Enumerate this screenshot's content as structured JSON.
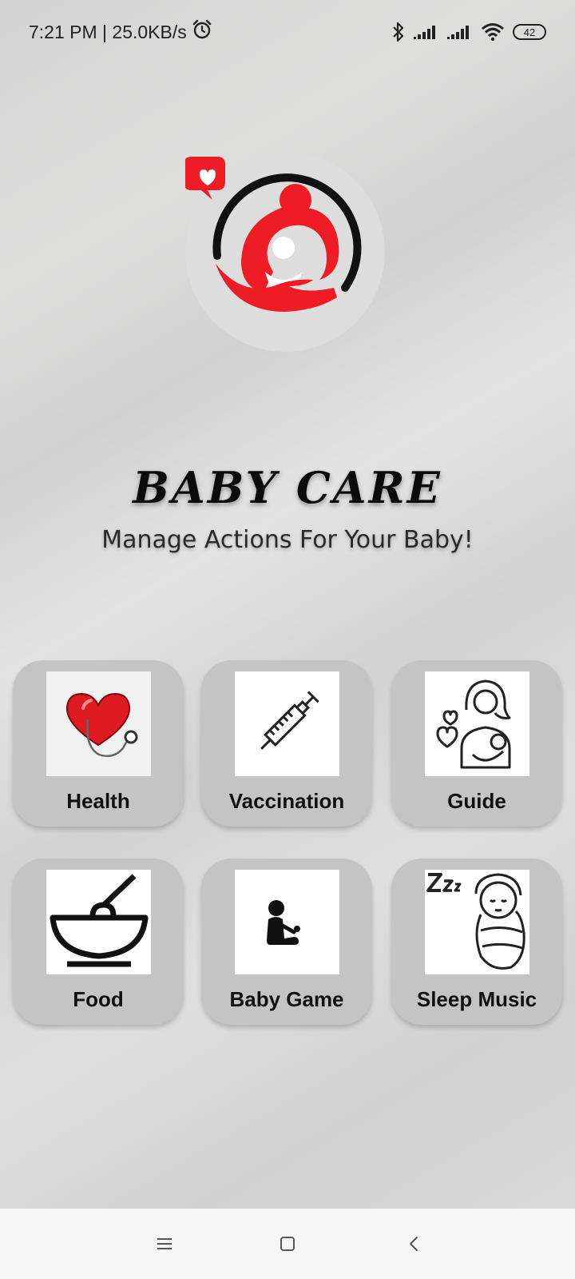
{
  "status_bar": {
    "time_speed": "7:21 PM | 25.0KB/s",
    "battery_level": "42",
    "icons": [
      "alarm-icon",
      "bluetooth-icon",
      "signal-icon",
      "signal-icon",
      "wifi-icon",
      "battery-icon"
    ]
  },
  "app": {
    "title": "BABY CARE",
    "subtitle": "Manage Actions For Your Baby!",
    "accent_color": "#ee1c24"
  },
  "menu": {
    "items": [
      {
        "label": "Health",
        "icon": "heart-stethoscope-icon"
      },
      {
        "label": "Vaccination",
        "icon": "syringe-icon"
      },
      {
        "label": "Guide",
        "icon": "mother-baby-icon"
      },
      {
        "label": "Food",
        "icon": "bowl-spoon-icon"
      },
      {
        "label": "Baby Game",
        "icon": "baby-playing-icon"
      },
      {
        "label": "Sleep Music",
        "icon": "sleeping-baby-icon"
      }
    ]
  },
  "nav_bar": {
    "icons": [
      "menu-icon",
      "home-icon",
      "back-icon"
    ]
  }
}
